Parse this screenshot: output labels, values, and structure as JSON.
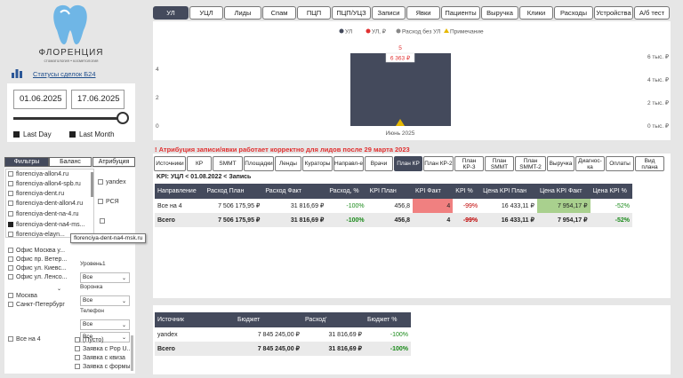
{
  "brand": {
    "name": "ФЛОРЕНЦИЯ",
    "tagline": "стоматология • косметология",
    "status_link": "Статусы сделок Б24"
  },
  "dates": {
    "start": "01.06.2025",
    "end": "17.06.2025",
    "last_day": "Last Day",
    "last_month": "Last Month"
  },
  "left_tabs": [
    "Фильтры",
    "Баланс",
    "Атрибуция"
  ],
  "filters": {
    "sources": [
      "florenciya-allon4.ru",
      "florenciya-allon4-spb.ru",
      "florenciya-dent.ru",
      "florenciya-dent-allon4.ru",
      "florenciya-dent-na-4.ru",
      "florenciya-dent-na4-ms...",
      "florenciya-elayn..."
    ],
    "tooltip": "florenciya-dent-na4-msk.ru",
    "right_sources": [
      "yandex",
      "РСЯ"
    ],
    "offices": [
      "Офис Москва у...",
      "Офис пр. Ветер...",
      "Офис ул. Киевс...",
      "Офис ул. Ленсо..."
    ],
    "cities": [
      "Москва",
      "Санкт-Петербург"
    ],
    "all4": "Все на 4",
    "level_label": "Уровень1",
    "level_value": "Все",
    "voronka_label": "Воронка",
    "voronka_value": "Все",
    "phone_label": "Телефон",
    "phone_value": "Все",
    "bottom_select": "Все",
    "bottom_list": [
      "(Пусто)",
      "Заявка с Pop U...",
      "Заявка с квиза",
      "Заявка с формы"
    ]
  },
  "top_tabs": [
    "УЛ",
    "УЦЛ",
    "Лиды",
    "Спам",
    "ПЦП",
    "ПЦП/УЦЗ",
    "Записи",
    "Явки",
    "Пациенты",
    "Выручка",
    "Клики",
    "Расходы",
    "Устройства",
    "А/б тест"
  ],
  "chart_data": {
    "type": "bar",
    "legend": [
      "УЛ",
      "УЛ, ₽",
      "Расход без УЛ",
      "Примечание"
    ],
    "legend_colors": [
      "#444a5c",
      "#e03030",
      "#888888",
      "#e6b800"
    ],
    "categories": [
      "Июнь 2025"
    ],
    "series": [
      {
        "name": "УЛ",
        "values": [
          5
        ]
      }
    ],
    "cost_label": "6 363 ₽",
    "count_label": "5",
    "ylim_left": [
      0,
      5
    ],
    "left_ticks": [
      "0",
      "2",
      "4"
    ],
    "right_ticks": [
      "0 тыс. ₽",
      "2 тыс. ₽",
      "4 тыс. ₽",
      "6 тыс. ₽"
    ]
  },
  "attribution_warning": "! Атрибуция записи/явки работает корректно для лидов после 29 марта 2023",
  "sub_tabs": [
    "Источники",
    "КР",
    "SMMT",
    "Площадки",
    "Ленды",
    "Кураторы",
    "Направл-е",
    "Врачи",
    "План КР",
    "План КР-2",
    "План КР-3",
    "План SMMT",
    "План SMMT-2",
    "Выручка",
    "Диагнос-ка",
    "Оплаты",
    "Вид плана"
  ],
  "kpi_caption": "KPI: УЦЛ < 01.08.2022 < Запись",
  "kpi_table": {
    "headers": [
      "Направление",
      "Расход План",
      "Расход Факт",
      "Расход, %",
      "KPI План",
      "KPI Факт",
      "KPI %",
      "Цена KPI План",
      "Цена KPI Факт",
      "Цена KPI %"
    ],
    "rows": [
      [
        "Все на 4",
        "7 506 175,95 ₽",
        "31 816,69 ₽",
        "-100%",
        "456,8",
        "4",
        "-99%",
        "16 433,11 ₽",
        "7 954,17 ₽",
        "-52%"
      ],
      [
        "Всего",
        "7 506 175,95 ₽",
        "31 816,69 ₽",
        "-100%",
        "456,8",
        "4",
        "-99%",
        "16 433,11 ₽",
        "7 954,17 ₽",
        "-52%"
      ]
    ]
  },
  "budget_table": {
    "headers": [
      "Источник",
      "Бюджет",
      "Расход'",
      "Бюджет %"
    ],
    "rows": [
      [
        "yandex",
        "7 845 245,00 ₽",
        "31 816,69 ₽",
        "-100%"
      ],
      [
        "Всего",
        "7 845 245,00 ₽",
        "31 816,69 ₽",
        "-100%"
      ]
    ]
  }
}
